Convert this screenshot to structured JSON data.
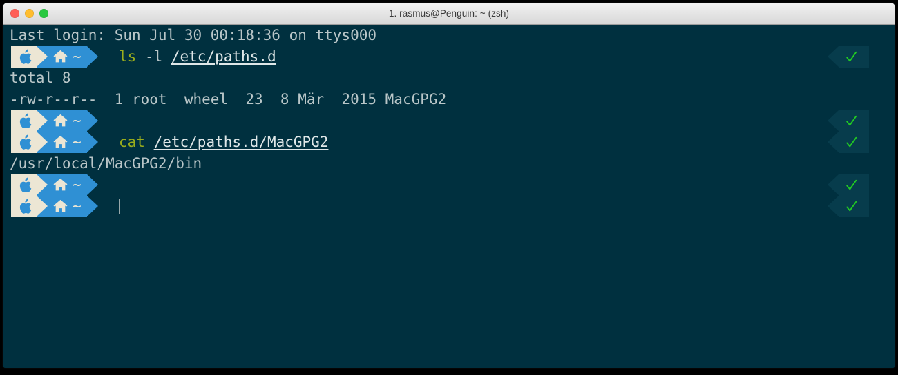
{
  "window": {
    "title": "1. rasmus@Penguin: ~ (zsh)",
    "traffic_lights": [
      {
        "name": "close",
        "color": "#ff5f57"
      },
      {
        "name": "minimize",
        "color": "#ffbd2e"
      },
      {
        "name": "zoom",
        "color": "#28c840"
      }
    ]
  },
  "theme": {
    "background": "#00303f",
    "foreground": "#b9c6c8",
    "prompt_apple_bg": "#ece6d4",
    "prompt_home_bg": "#2f90d4",
    "status_bg": "#073c4c",
    "status_check": "#22cc22",
    "command_color": "#9aad1c",
    "path_color": "#dfe7e8",
    "titlebar_bg": "#e6e6e6"
  },
  "terminal": {
    "shell": "zsh",
    "prompt": {
      "apple_icon": "apple-logo-icon",
      "home_icon": "home-icon",
      "cwd_label": "~",
      "status_icon": "checkmark-icon"
    },
    "lines": [
      {
        "type": "output",
        "text": "Last login: Sun Jul 30 00:18:36 on ttys000"
      },
      {
        "type": "prompt",
        "command": "ls",
        "args": " -l ",
        "path": "/etc/paths.d",
        "status": "ok"
      },
      {
        "type": "output",
        "text": "total 8"
      },
      {
        "type": "output",
        "text": "-rw-r--r--  1 root  wheel  23  8 Mär  2015 MacGPG2"
      },
      {
        "type": "prompt",
        "command": "",
        "args": "",
        "path": "",
        "status": "ok"
      },
      {
        "type": "prompt",
        "command": "cat",
        "args": " ",
        "path": "/etc/paths.d/MacGPG2",
        "status": "ok"
      },
      {
        "type": "output",
        "text": "/usr/local/MacGPG2/bin"
      },
      {
        "type": "prompt",
        "command": "",
        "args": "",
        "path": "",
        "status": "ok"
      },
      {
        "type": "prompt",
        "command": "",
        "args": "",
        "path": "",
        "status": "ok",
        "cursor": true
      }
    ]
  }
}
